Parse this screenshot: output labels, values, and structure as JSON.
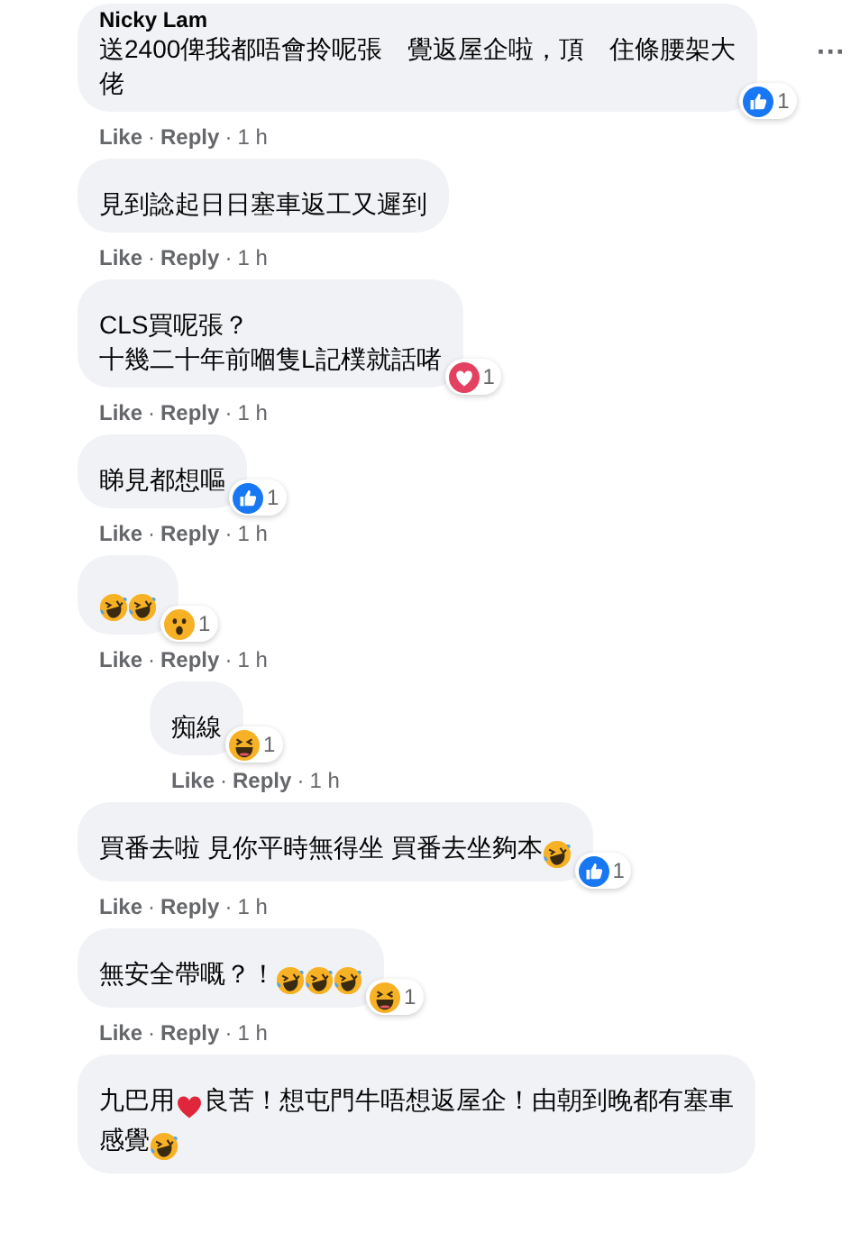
{
  "menu_glyph": "···",
  "separator": "·",
  "comments": [
    {
      "author": "Nicky Lam",
      "menu": true,
      "segments": [
        {
          "kind": "text",
          "text": "送2400俾我都唔會拎呢張　覺返屋企啦，頂　住條腰架大"
        },
        {
          "kind": "break"
        },
        {
          "kind": "text",
          "text": "佬"
        }
      ],
      "reactions": [
        {
          "kind": "like"
        }
      ],
      "reaction_count": "1",
      "actions": [
        "Like",
        "Reply"
      ],
      "time": "1 h"
    },
    {
      "segments": [
        {
          "kind": "text",
          "text": "見到諗起日日塞車返工又遲到"
        }
      ],
      "actions": [
        "Like",
        "Reply"
      ],
      "time": "1 h"
    },
    {
      "segments": [
        {
          "kind": "text",
          "text": "CLS買呢張？"
        },
        {
          "kind": "break"
        },
        {
          "kind": "text",
          "text": "十幾二十年前嗰隻L記樸就話啫"
        }
      ],
      "reactions": [
        {
          "kind": "love"
        }
      ],
      "reaction_count": "1",
      "actions": [
        "Like",
        "Reply"
      ],
      "time": "1 h"
    },
    {
      "segments": [
        {
          "kind": "text",
          "text": "睇見都想嘔"
        }
      ],
      "reactions": [
        {
          "kind": "like"
        }
      ],
      "reaction_count": "1",
      "actions": [
        "Like",
        "Reply"
      ],
      "time": "1 h"
    },
    {
      "segments": [
        {
          "kind": "laugh"
        },
        {
          "kind": "laugh"
        }
      ],
      "reactions": [
        {
          "kind": "wow"
        }
      ],
      "reaction_count": "1",
      "actions": [
        "Like",
        "Reply"
      ],
      "time": "1 h",
      "replies": [
        {
          "segments": [
            {
              "kind": "text",
              "text": "痴線"
            }
          ],
          "reactions": [
            {
              "kind": "haha"
            }
          ],
          "reaction_count": "1",
          "actions": [
            "Like",
            "Reply"
          ],
          "time": "1 h"
        }
      ]
    },
    {
      "segments": [
        {
          "kind": "text",
          "text": "買番去啦 見你平時無得坐 買番去坐夠本"
        },
        {
          "kind": "laugh"
        }
      ],
      "reactions": [
        {
          "kind": "like"
        }
      ],
      "reaction_count": "1",
      "actions": [
        "Like",
        "Reply"
      ],
      "time": "1 h"
    },
    {
      "segments": [
        {
          "kind": "text",
          "text": "無安全帶嘅？！"
        },
        {
          "kind": "laugh"
        },
        {
          "kind": "laugh"
        },
        {
          "kind": "laugh"
        }
      ],
      "reactions": [
        {
          "kind": "haha"
        }
      ],
      "reaction_count": "1",
      "actions": [
        "Like",
        "Reply"
      ],
      "time": "1 h"
    },
    {
      "segments": [
        {
          "kind": "text",
          "text": "九巴用"
        },
        {
          "kind": "heart"
        },
        {
          "kind": "text",
          "text": "良苦！想屯門牛唔想返屋企！由朝到晚都有塞車"
        },
        {
          "kind": "break"
        },
        {
          "kind": "text",
          "text": "感覺"
        },
        {
          "kind": "laugh"
        }
      ]
    }
  ]
}
